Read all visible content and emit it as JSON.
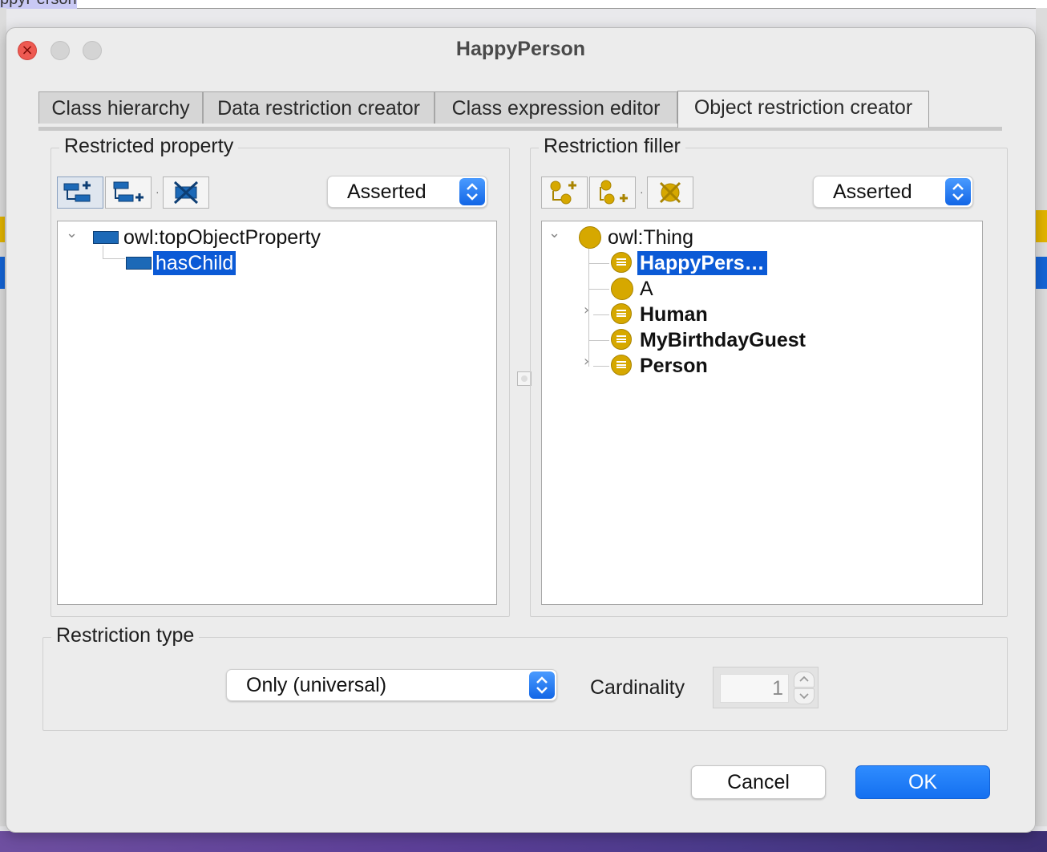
{
  "background_app": {
    "top_text": "ppyPerson"
  },
  "dialog": {
    "title": "HappyPerson",
    "tabs": [
      {
        "label": "Class hierarchy"
      },
      {
        "label": "Data restriction creator"
      },
      {
        "label": "Class expression editor"
      },
      {
        "label": "Object restriction creator"
      }
    ],
    "active_tab": "Object restriction creator"
  },
  "restricted_property": {
    "title": "Restricted property",
    "toolbar": [
      "add-subproperty-icon",
      "add-sibling-property-icon",
      "delete-property-icon"
    ],
    "mode_select": "Asserted",
    "tree": [
      {
        "label": "owl:topObjectProperty",
        "expanded": true
      },
      {
        "label": "hasChild",
        "selected": true
      }
    ]
  },
  "restriction_filler": {
    "title": "Restriction filler",
    "toolbar": [
      "add-subclass-icon",
      "add-sibling-class-icon",
      "delete-class-icon"
    ],
    "mode_select": "Asserted",
    "tree": [
      {
        "label": "owl:Thing",
        "expanded": true
      },
      {
        "label": "HappyPers…",
        "selected": true
      },
      {
        "label": "A"
      },
      {
        "label": "Human",
        "has_children": true
      },
      {
        "label": "MyBirthdayGuest"
      },
      {
        "label": "Person",
        "has_children": true
      }
    ]
  },
  "restriction_type": {
    "title": "Restriction type",
    "selected": "Only (universal)",
    "cardinality_label": "Cardinality",
    "cardinality_value": "1"
  },
  "buttons": {
    "cancel": "Cancel",
    "ok": "OK"
  },
  "colors": {
    "selection": "#0b5ad6",
    "property_icon": "#1c69b7",
    "class_icon": "#d6a800",
    "ok_button": "#1470f0"
  }
}
